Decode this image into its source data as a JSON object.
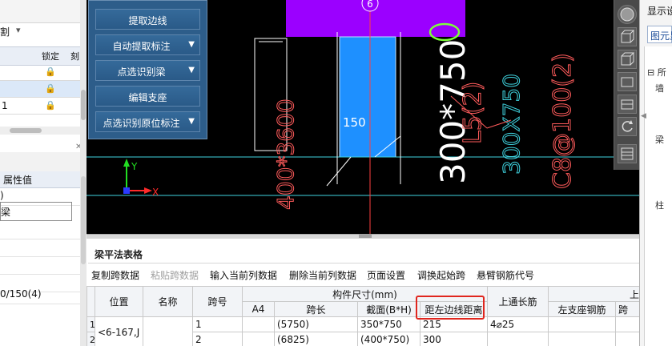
{
  "left_panel": {
    "split_label": "割",
    "layer_headers": [
      "锁定",
      "刻"
    ],
    "layer_rows": [
      {
        "text": ""
      },
      {
        "text": ""
      },
      {
        "text": "1"
      }
    ],
    "property_header": "属性值",
    "property_rows": [
      {
        "text": ")"
      },
      {
        "text": "梁"
      },
      {
        "text": ""
      },
      {
        "text": ""
      },
      {
        "text": ""
      },
      {
        "text": ""
      },
      {
        "text": "0/150(4)"
      }
    ]
  },
  "command_panel": {
    "buttons": [
      {
        "label": "提取边线",
        "dropdown": false
      },
      {
        "label": "自动提取标注",
        "dropdown": true
      },
      {
        "label": "点选识别梁",
        "dropdown": true
      },
      {
        "label": "编辑支座",
        "dropdown": false
      },
      {
        "label": "点选识别原位标注",
        "dropdown": true
      }
    ]
  },
  "canvas": {
    "axis_number": "6",
    "beam_width_label": "150",
    "dimension_big": "300*750",
    "red_text_1": "400*3600",
    "red_text_2": "L5(2)",
    "red_text_3": "C8@100(2)",
    "cyan_text": "300X750",
    "axis_x": "X",
    "axis_y": "Y",
    "colors": {
      "background": "#000000",
      "purple_block": "#9b00ff",
      "blue_column": "#1e90ff",
      "red_lines": "#ff5b5b",
      "cyan_lines": "#3fd4e0",
      "green_circle": "#7dff3a"
    }
  },
  "right_panel": {
    "title": "显示设",
    "tab": "图元显",
    "tree": [
      "所",
      "墙",
      "梁",
      "柱"
    ]
  },
  "bottom": {
    "title": "梁平法表格",
    "toolbar": [
      {
        "label": "复制跨数据",
        "disabled": false
      },
      {
        "label": "粘贴跨数据",
        "disabled": true
      },
      {
        "label": "输入当前列数据",
        "disabled": false
      },
      {
        "label": "删除当前列数据",
        "disabled": false
      },
      {
        "label": "页面设置",
        "disabled": false
      },
      {
        "label": "调换起始跨",
        "disabled": false
      },
      {
        "label": "悬臂钢筋代号",
        "disabled": false
      }
    ],
    "header_group_size": "构件尺寸(mm)",
    "header_group_top": "上部",
    "columns": {
      "position": "位置",
      "name": "名称",
      "span_no": "跨号",
      "a4": "A4",
      "span_length": "跨长",
      "section": "截面(B*H)",
      "dist_left": "距左边线距离",
      "top_through": "上通长筋",
      "left_support": "左支座钢筋",
      "span_cut": "跨"
    },
    "rows": [
      {
        "num": "1",
        "position": "<6-167,J",
        "name": "",
        "span_no": "1",
        "a4": "",
        "span_length": "(5750)",
        "section": "350*750",
        "dist_left": "215",
        "top_through": "4⌀25",
        "left_support": "",
        "span_cut": ""
      },
      {
        "num": "2",
        "position": "",
        "name": "",
        "span_no": "2",
        "a4": "",
        "span_length": "(6825)",
        "section": "(400*750)",
        "dist_left": "300",
        "top_through": "",
        "left_support": "",
        "span_cut": ""
      }
    ]
  }
}
